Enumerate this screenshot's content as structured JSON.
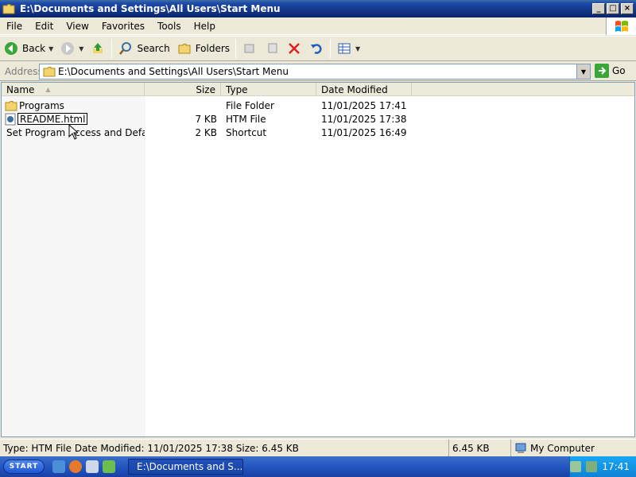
{
  "window": {
    "title": "E:\\Documents and Settings\\All Users\\Start Menu"
  },
  "menu": [
    {
      "label": "File"
    },
    {
      "label": "Edit"
    },
    {
      "label": "View"
    },
    {
      "label": "Favorites"
    },
    {
      "label": "Tools"
    },
    {
      "label": "Help"
    }
  ],
  "toolbar": {
    "back_label": "Back",
    "search_label": "Search",
    "folders_label": "Folders"
  },
  "address": {
    "label": "Address",
    "value": "E:\\Documents and Settings\\All Users\\Start Menu",
    "go_label": "Go"
  },
  "columns": {
    "name": "Name",
    "size": "Size",
    "type": "Type",
    "date": "Date Modified"
  },
  "files": [
    {
      "name": "Programs",
      "size": "",
      "type": "File Folder",
      "date": "11/01/2025 17:41",
      "icon": "folder-icon"
    },
    {
      "name": "README.html",
      "size": "7 KB",
      "type": "HTM File",
      "date": "11/01/2025 17:38",
      "icon": "html-file-icon",
      "renaming": true
    },
    {
      "name": "Set Program Access and Defa...",
      "size": "2 KB",
      "type": "Shortcut",
      "date": "11/01/2025 16:49",
      "icon": "shortcut-icon"
    }
  ],
  "status": {
    "info": "Type: HTM File Date Modified: 11/01/2025 17:38 Size: 6.45 KB",
    "size": "6.45 KB",
    "zone": "My Computer"
  },
  "taskbar": {
    "start_label": "START",
    "task_label": "E:\\Documents and S...",
    "clock": "17:41"
  },
  "colors": {
    "titlebar": "#0a246a",
    "taskbar": "#2456c1",
    "tray": "#0f83d6"
  }
}
